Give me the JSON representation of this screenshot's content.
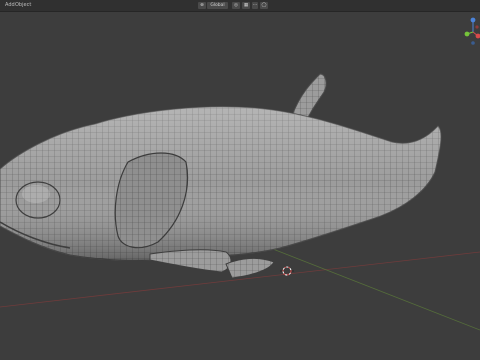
{
  "header": {
    "menu": [
      "Add",
      "Object"
    ],
    "orientation_label": "Global",
    "colors": {
      "bar": "#303030",
      "viewport": "#3d3d3d"
    }
  },
  "viewport": {
    "object": "mesh-wireframe",
    "grid_axis_colors": {
      "x": "#7c3b3b",
      "y": "#5b7a3a"
    },
    "gizmo_colors": {
      "x": "#d94b4b",
      "y": "#76c43a",
      "z": "#4b83d9"
    }
  }
}
